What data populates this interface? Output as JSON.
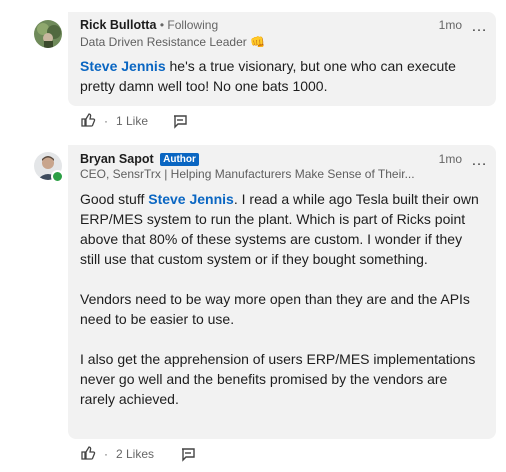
{
  "comments": [
    {
      "author": "Rick Bullotta",
      "connection": "• Following",
      "headline": "Data Driven Resistance Leader",
      "headline_emoji": "👊",
      "time": "1mo",
      "more": "…",
      "mention": "Steve Jennis",
      "text": " he's a true visionary, but one who can execute pretty damn well too!  No one bats 1000.",
      "like_count": "1 Like",
      "dot": "·"
    },
    {
      "author": "Bryan Sapot",
      "badge": "Author",
      "headline": "CEO, SensrTrx | Helping Manufacturers Make Sense of Their...",
      "time": "1mo",
      "more": "…",
      "p1_prefix": "Good stuff ",
      "mention": "Steve Jennis",
      "p1_suffix": ". I read a while ago Tesla built their own ERP/MES system to run the plant. Which is part of Ricks point above that 80% of these systems are custom. I wonder if they still use that custom system or if they bought something.",
      "p2": "Vendors need to be way more open than they are and the APIs need to be easier to use.",
      "p3": "I also get the apprehension of users ERP/MES implementations never go well and the benefits promised by the vendors are rarely achieved.",
      "like_count": "2 Likes",
      "dot": "·"
    }
  ],
  "colors": {
    "mention": "#0a66c2",
    "bubble": "#f2f2f2",
    "online": "#2c9f45"
  }
}
